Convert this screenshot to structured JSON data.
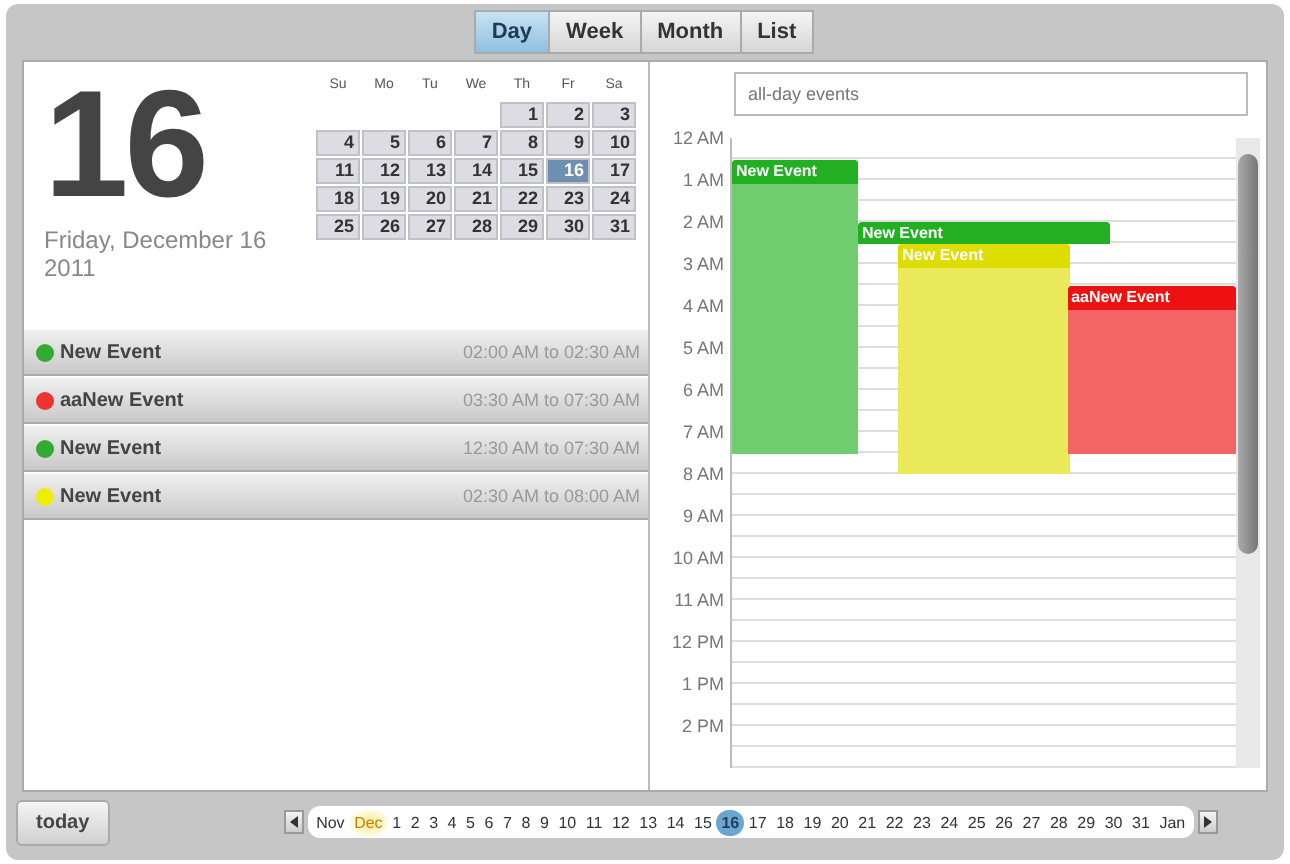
{
  "view_tabs": [
    {
      "label": "Day",
      "selected": true
    },
    {
      "label": "Week",
      "selected": false
    },
    {
      "label": "Month",
      "selected": false
    },
    {
      "label": "List",
      "selected": false
    }
  ],
  "day_header": {
    "day_number": "16",
    "date": "Friday, December 16 2011"
  },
  "mini_calendar": {
    "weekdays": [
      "Su",
      "Mo",
      "Tu",
      "We",
      "Th",
      "Fr",
      "Sa"
    ],
    "weeks": [
      [
        {
          "label": "1",
          "selected": false
        },
        {
          "label": "2",
          "selected": false
        },
        {
          "label": "3",
          "selected": false
        }
      ],
      [
        {
          "label": "4",
          "selected": false
        },
        {
          "label": "5",
          "selected": false
        },
        {
          "label": "6",
          "selected": false
        },
        {
          "label": "7",
          "selected": false
        },
        {
          "label": "8",
          "selected": false
        },
        {
          "label": "9",
          "selected": false
        },
        {
          "label": "10",
          "selected": false
        }
      ],
      [
        {
          "label": "11",
          "selected": false
        },
        {
          "label": "12",
          "selected": false
        },
        {
          "label": "13",
          "selected": false
        },
        {
          "label": "14",
          "selected": false
        },
        {
          "label": "15",
          "selected": false
        },
        {
          "label": "16",
          "selected": true
        },
        {
          "label": "17",
          "selected": false
        }
      ],
      [
        {
          "label": "18",
          "selected": false
        },
        {
          "label": "19",
          "selected": false
        },
        {
          "label": "20",
          "selected": false
        },
        {
          "label": "21",
          "selected": false
        },
        {
          "label": "22",
          "selected": false
        },
        {
          "label": "23",
          "selected": false
        },
        {
          "label": "24",
          "selected": false
        }
      ],
      [
        {
          "label": "25",
          "selected": false
        },
        {
          "label": "26",
          "selected": false
        },
        {
          "label": "27",
          "selected": false
        },
        {
          "label": "28",
          "selected": false
        },
        {
          "label": "29",
          "selected": false
        },
        {
          "label": "30",
          "selected": false
        },
        {
          "label": "31",
          "selected": false
        }
      ]
    ]
  },
  "event_list": [
    {
      "title": "New Event",
      "time": "02:00 AM to 02:30 AM",
      "color": "#33aa33"
    },
    {
      "title": "aaNew Event",
      "time": "03:30 AM to 07:30 AM",
      "color": "#ee3333"
    },
    {
      "title": "New Event",
      "time": "12:30 AM to 07:30 AM",
      "color": "#33aa33"
    },
    {
      "title": "New Event",
      "time": "02:30 AM to 08:00 AM",
      "color": "#eeee00"
    }
  ],
  "day_view": {
    "all_day_placeholder": "all-day events",
    "hours": [
      "12 AM",
      "1 AM",
      "2 AM",
      "3 AM",
      "4 AM",
      "5 AM",
      "6 AM",
      "7 AM",
      "8 AM",
      "9 AM",
      "10 AM",
      "11 AM",
      "12 PM",
      "1 PM",
      "2 PM"
    ],
    "events": [
      {
        "title": "New Event",
        "color": "#22b022"
      },
      {
        "title": "New Event",
        "color": "#22b022"
      },
      {
        "title": "New Event",
        "color": "#dddd00"
      },
      {
        "title": "aaNew Event",
        "color": "#ee1111"
      }
    ]
  },
  "today_button": "today",
  "timeline": [
    {
      "label": "Nov",
      "kind": "month",
      "selected": false
    },
    {
      "label": "Dec",
      "kind": "month",
      "selected": true
    },
    {
      "label": "1",
      "kind": "day",
      "selected": false
    },
    {
      "label": "2",
      "kind": "day",
      "selected": false
    },
    {
      "label": "3",
      "kind": "day",
      "selected": false
    },
    {
      "label": "4",
      "kind": "day",
      "selected": false
    },
    {
      "label": "5",
      "kind": "day",
      "selected": false
    },
    {
      "label": "6",
      "kind": "day",
      "selected": false
    },
    {
      "label": "7",
      "kind": "day",
      "selected": false
    },
    {
      "label": "8",
      "kind": "day",
      "selected": false
    },
    {
      "label": "9",
      "kind": "day",
      "selected": false
    },
    {
      "label": "10",
      "kind": "day",
      "selected": false
    },
    {
      "label": "11",
      "kind": "day",
      "selected": false
    },
    {
      "label": "12",
      "kind": "day",
      "selected": false
    },
    {
      "label": "13",
      "kind": "day",
      "selected": false
    },
    {
      "label": "14",
      "kind": "day",
      "selected": false
    },
    {
      "label": "15",
      "kind": "day",
      "selected": false
    },
    {
      "label": "16",
      "kind": "day",
      "selected": true
    },
    {
      "label": "17",
      "kind": "day",
      "selected": false
    },
    {
      "label": "18",
      "kind": "day",
      "selected": false
    },
    {
      "label": "19",
      "kind": "day",
      "selected": false
    },
    {
      "label": "20",
      "kind": "day",
      "selected": false
    },
    {
      "label": "21",
      "kind": "day",
      "selected": false
    },
    {
      "label": "22",
      "kind": "day",
      "selected": false
    },
    {
      "label": "23",
      "kind": "day",
      "selected": false
    },
    {
      "label": "24",
      "kind": "day",
      "selected": false
    },
    {
      "label": "25",
      "kind": "day",
      "selected": false
    },
    {
      "label": "26",
      "kind": "day",
      "selected": false
    },
    {
      "label": "27",
      "kind": "day",
      "selected": false
    },
    {
      "label": "28",
      "kind": "day",
      "selected": false
    },
    {
      "label": "29",
      "kind": "day",
      "selected": false
    },
    {
      "label": "30",
      "kind": "day",
      "selected": false
    },
    {
      "label": "31",
      "kind": "day",
      "selected": false
    },
    {
      "label": "Jan",
      "kind": "month",
      "selected": false
    }
  ]
}
